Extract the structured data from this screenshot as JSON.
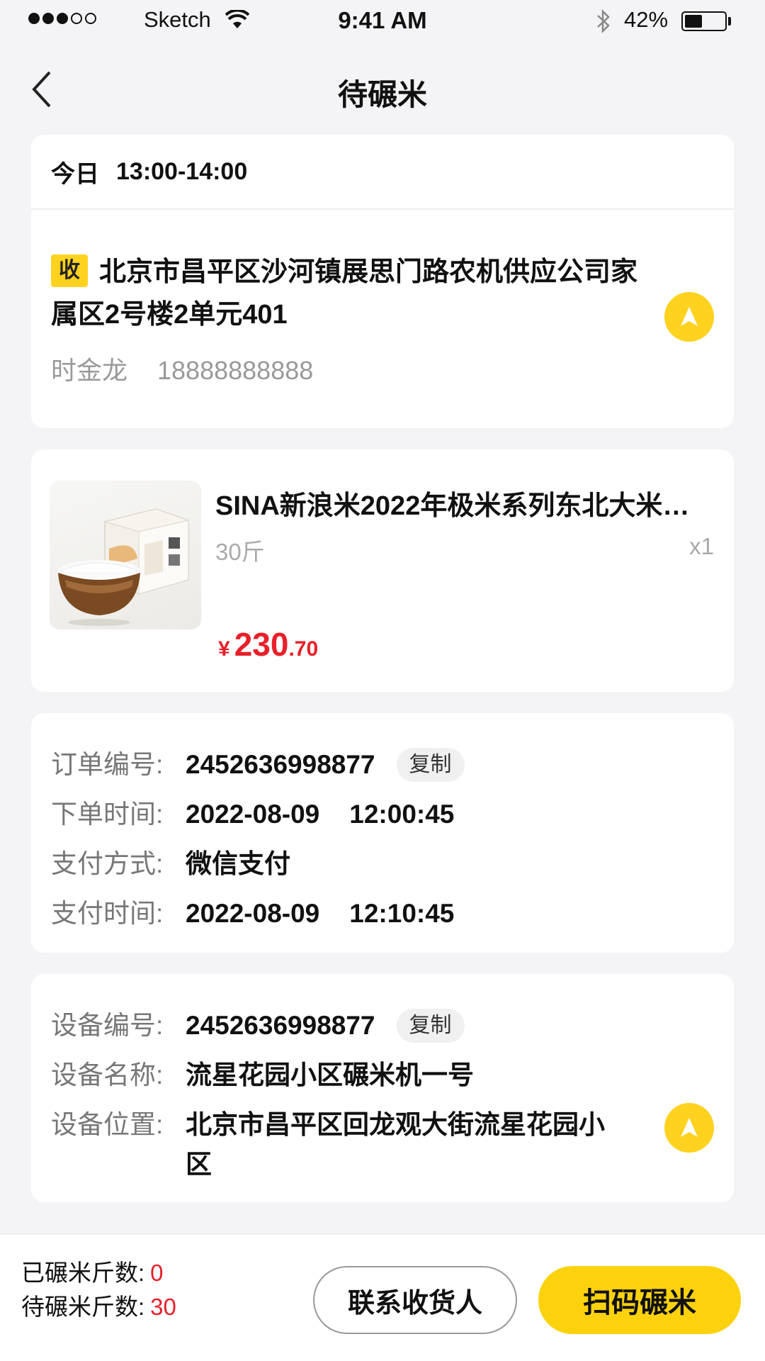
{
  "status_bar": {
    "carrier": "Sketch",
    "time": "9:41 AM",
    "battery": "42%",
    "signal_strength": 3
  },
  "nav": {
    "title": "待碾米",
    "back_icon": "chevron-left-icon"
  },
  "delivery": {
    "day": "今日",
    "time_range": "13:00-14:00",
    "tag": "收",
    "address": "北京市昌平区沙河镇展思门路农机供应公司家属区2号楼2单元401",
    "receiver_name": "时金龙",
    "receiver_phone": "18888888888",
    "nav_icon": "navigation-arrow-icon"
  },
  "product": {
    "name": "SINA新浪米2022年极米系列东北大米…",
    "spec": "30斤",
    "qty": "x1",
    "price_currency": "¥",
    "price_int": "230",
    "price_dec": ".70"
  },
  "order": {
    "number_label": "订单编号:",
    "number": "2452636998877",
    "copy_label": "复制",
    "order_time_label": "下单时间:",
    "order_date": "2022-08-09",
    "order_clock": "12:00:45",
    "pay_method_label": "支付方式:",
    "pay_method": "微信支付",
    "pay_time_label": "支付时间:",
    "pay_date": "2022-08-09",
    "pay_clock": "12:10:45"
  },
  "device": {
    "number_label": "设备编号:",
    "number": "2452636998877",
    "copy_label": "复制",
    "name_label": "设备名称:",
    "name": "流星花园小区碾米机一号",
    "location_label": "设备位置:",
    "location": "北京市昌平区回龙观大街流星花园小区",
    "nav_icon": "navigation-arrow-icon"
  },
  "bottom": {
    "milled_label": "已碾米斤数:",
    "milled_value": "0",
    "pending_label": "待碾米斤数:",
    "pending_value": "30",
    "contact_button": "联系收货人",
    "scan_button": "扫码碾米"
  },
  "colors": {
    "accent_yellow": "#fcd20f",
    "price_red": "#e8202a",
    "background": "#f4f4f6"
  }
}
